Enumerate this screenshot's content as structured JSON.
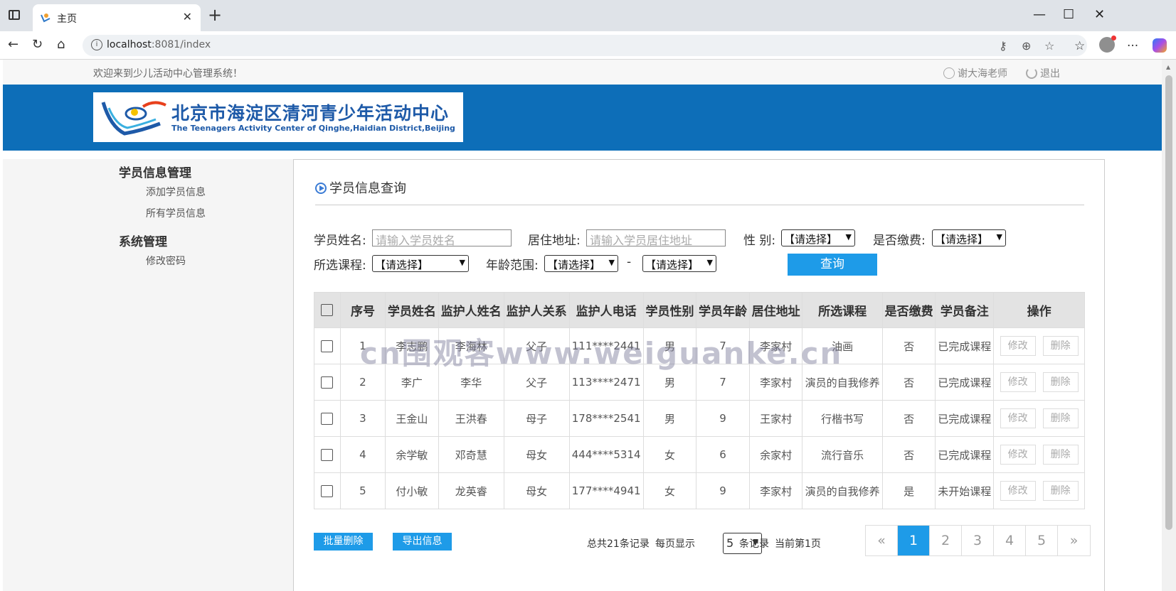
{
  "browser": {
    "tab_title": "主页",
    "url_host": "localhost",
    "url_path": ":8081/index"
  },
  "header": {
    "welcome": "欢迎来到少儿活动中心管理系统！",
    "user": "谢大海老师",
    "logout": "退出"
  },
  "logo": {
    "cn": "北京市海淀区清河青少年活动中心",
    "en": "The Teenagers Activity Center of Qinghe,Haidian District,Beijing"
  },
  "sidebar": {
    "groups": [
      {
        "title": "学员信息管理",
        "items": [
          "添加学员信息",
          "所有学员信息"
        ]
      },
      {
        "title": "系统管理",
        "items": [
          "修改密码"
        ]
      }
    ]
  },
  "section_title": "学员信息查询",
  "search": {
    "name_label": "学员姓名:",
    "name_placeholder": "请输入学员姓名",
    "address_label": "居住地址:",
    "address_placeholder": "请输入学员居住地址",
    "gender_label": "性 别:",
    "gender_value": "【请选择】",
    "paid_label": "是否缴费:",
    "paid_value": "【请选择】",
    "course_label": "所选课程:",
    "course_value": "【请选择】",
    "age_label": "年龄范围:",
    "age_from": "【请选择】",
    "age_sep": "-",
    "age_to": "【请选择】",
    "query_button": "查询"
  },
  "table": {
    "headers": [
      "序号",
      "学员姓名",
      "监护人姓名",
      "监护人关系",
      "监护人电话",
      "学员性别",
      "学员年龄",
      "居住地址",
      "所选课程",
      "是否缴费",
      "学员备注",
      "操作"
    ],
    "edit_label": "修改",
    "delete_label": "删除",
    "rows": [
      [
        "1",
        "李志鹏",
        "李海林",
        "父子",
        "111****2441",
        "男",
        "7",
        "李家村",
        "油画",
        "否",
        "已完成课程"
      ],
      [
        "2",
        "李广",
        "李华",
        "父子",
        "113****2471",
        "男",
        "7",
        "李家村",
        "演员的自我修养",
        "否",
        "已完成课程"
      ],
      [
        "3",
        "王金山",
        "王洪春",
        "母子",
        "178****2541",
        "男",
        "9",
        "王家村",
        "行楷书写",
        "否",
        "已完成课程"
      ],
      [
        "4",
        "余学敏",
        "邓奇慧",
        "母女",
        "444****5314",
        "女",
        "6",
        "余家村",
        "流行音乐",
        "否",
        "已完成课程"
      ],
      [
        "5",
        "付小敏",
        "龙英睿",
        "母女",
        "177****4941",
        "女",
        "9",
        "李家村",
        "演员的自我修养",
        "是",
        "未开始课程"
      ]
    ]
  },
  "footer": {
    "batch_delete": "批量删除",
    "export": "导出信息",
    "total": "总共21条记录",
    "per_page_label": "每页显示",
    "per_page_value": "5",
    "records_label": "条记录",
    "current_page": "当前第1页",
    "pages": [
      "«",
      "1",
      "2",
      "3",
      "4",
      "5",
      "»"
    ],
    "active_page": "1"
  },
  "watermark": "cn围观客www.weiguanke.cn"
}
